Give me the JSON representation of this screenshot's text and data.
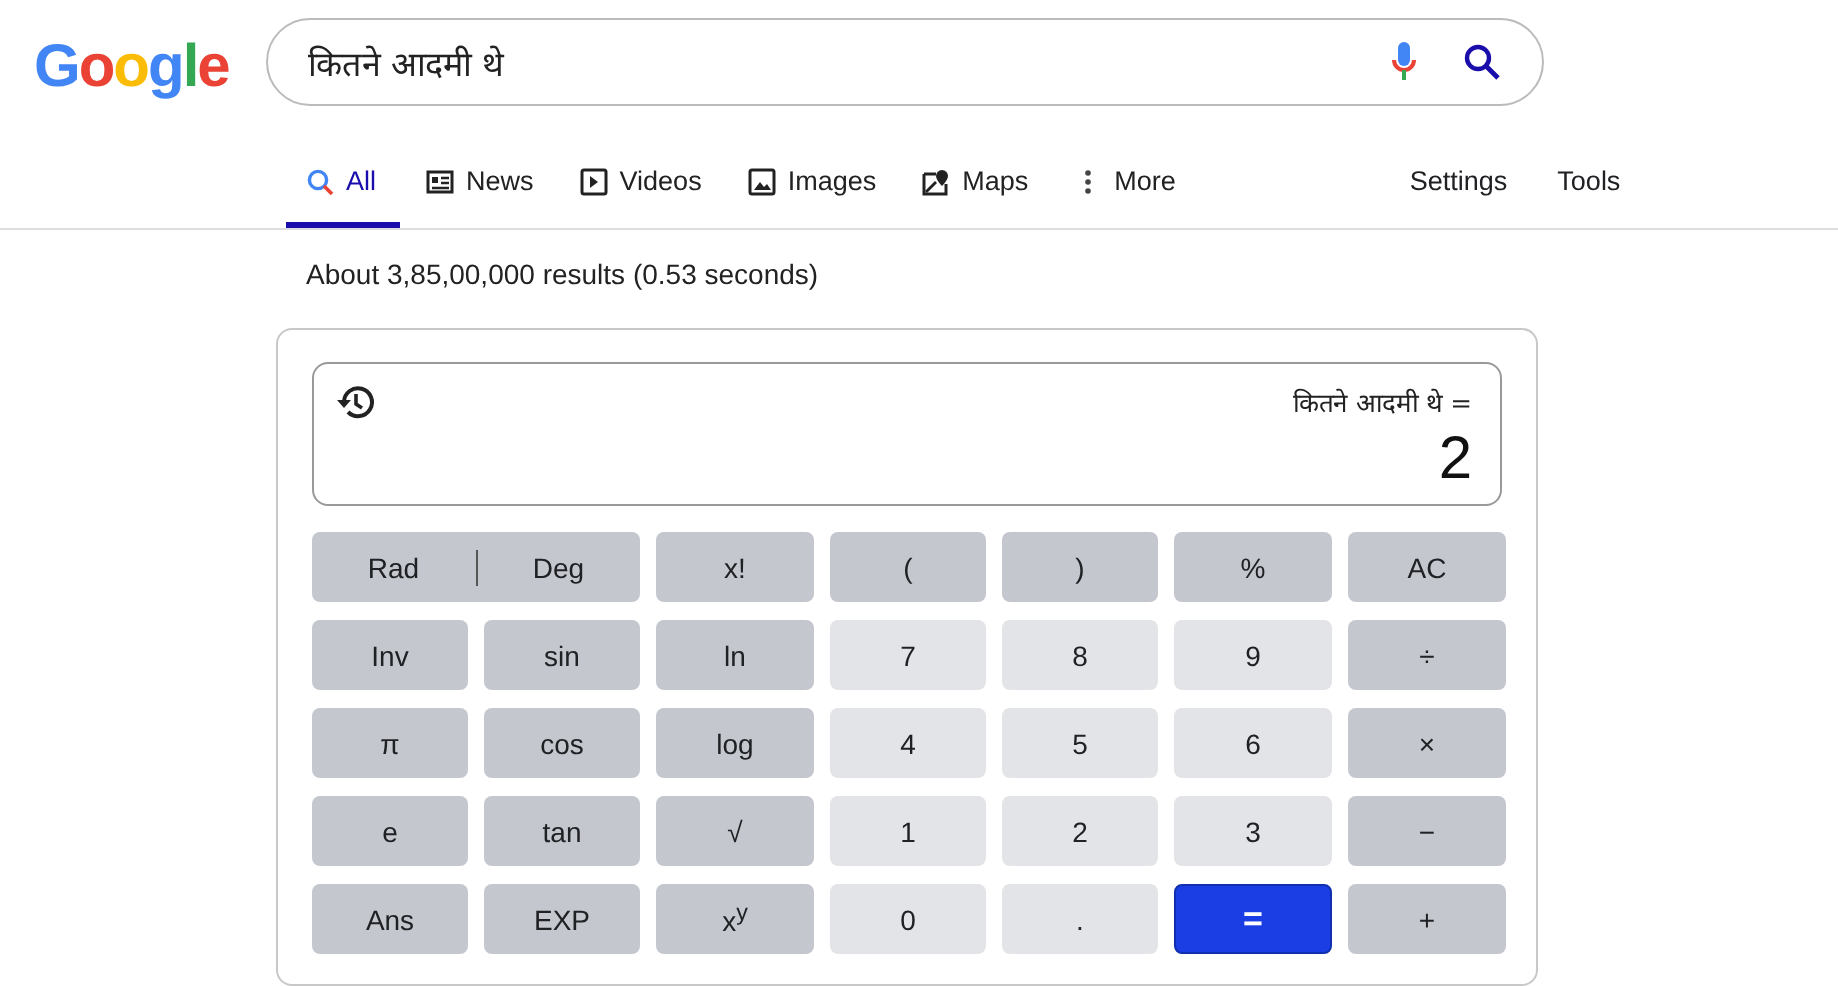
{
  "logo": "Google",
  "search": {
    "value": "कितने आदमी थे"
  },
  "tabs": [
    {
      "label": "All",
      "kind": "search",
      "selected": true
    },
    {
      "label": "News",
      "kind": "news",
      "selected": false
    },
    {
      "label": "Videos",
      "kind": "video",
      "selected": false
    },
    {
      "label": "Images",
      "kind": "image",
      "selected": false
    },
    {
      "label": "Maps",
      "kind": "map",
      "selected": false
    },
    {
      "label": "More",
      "kind": "more",
      "selected": false
    }
  ],
  "tools": [
    "Settings",
    "Tools"
  ],
  "result_stats": "About 3,85,00,000 results (0.53 seconds)",
  "calculator": {
    "expression": "कितने आदमी थे =",
    "result": "2",
    "keys": [
      {
        "kind": "angle",
        "options": [
          "Rad",
          "Deg"
        ]
      },
      {
        "kind": "op",
        "label": "x!"
      },
      {
        "kind": "op",
        "label": "("
      },
      {
        "kind": "op",
        "label": ")"
      },
      {
        "kind": "op",
        "label": "%"
      },
      {
        "kind": "op",
        "label": "AC"
      },
      {
        "kind": "op",
        "label": "Inv"
      },
      {
        "kind": "op",
        "label": "sin"
      },
      {
        "kind": "op",
        "label": "ln"
      },
      {
        "kind": "num",
        "label": "7"
      },
      {
        "kind": "num",
        "label": "8"
      },
      {
        "kind": "num",
        "label": "9"
      },
      {
        "kind": "op",
        "label": "÷"
      },
      {
        "kind": "op",
        "label": "π"
      },
      {
        "kind": "op",
        "label": "cos"
      },
      {
        "kind": "op",
        "label": "log"
      },
      {
        "kind": "num",
        "label": "4"
      },
      {
        "kind": "num",
        "label": "5"
      },
      {
        "kind": "num",
        "label": "6"
      },
      {
        "kind": "op",
        "label": "×"
      },
      {
        "kind": "op",
        "label": "e"
      },
      {
        "kind": "op",
        "label": "tan"
      },
      {
        "kind": "op",
        "label": "√"
      },
      {
        "kind": "num",
        "label": "1"
      },
      {
        "kind": "num",
        "label": "2"
      },
      {
        "kind": "num",
        "label": "3"
      },
      {
        "kind": "op",
        "label": "−"
      },
      {
        "kind": "op",
        "label": "Ans"
      },
      {
        "kind": "op",
        "label": "EXP"
      },
      {
        "kind": "op",
        "label": "x$^{y}$"
      },
      {
        "kind": "num",
        "label": "0"
      },
      {
        "kind": "num",
        "label": "."
      },
      {
        "kind": "equals",
        "label": "="
      },
      {
        "kind": "op",
        "label": "+"
      }
    ]
  }
}
